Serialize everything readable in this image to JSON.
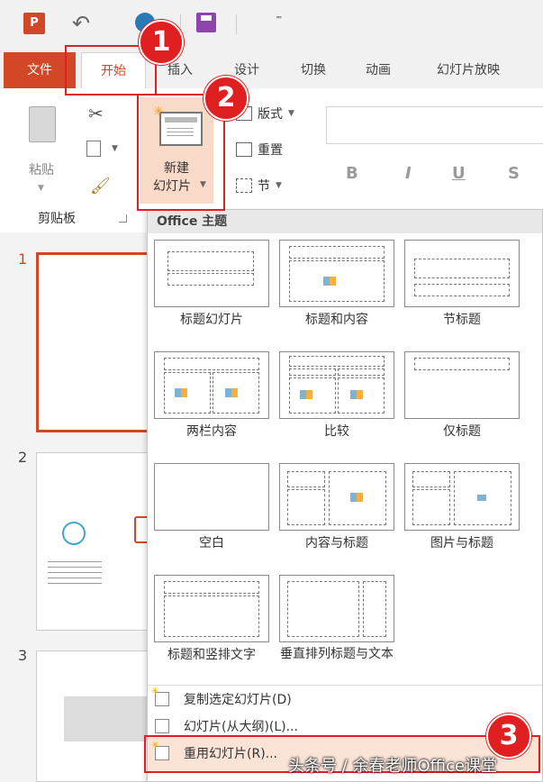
{
  "tabs": {
    "file": "文件",
    "home": "开始",
    "insert": "插入",
    "design": "设计",
    "transitions": "切换",
    "animations": "动画",
    "slideshow": "幻灯片放映"
  },
  "qat": {
    "app_icon_letter": "P",
    "more": "⁼"
  },
  "clipboard": {
    "paste": "粘贴",
    "group_label": "剪贴板"
  },
  "slides_group": {
    "new_slide_line1": "新建",
    "new_slide_line2": "幻灯片",
    "layout": "版式",
    "reset": "重置",
    "section": "节"
  },
  "font_group": {
    "bold": "B",
    "italic": "I",
    "underline": "U",
    "shadow": "S"
  },
  "badges": {
    "one": "1",
    "two": "2",
    "three": "3"
  },
  "slide_panel": {
    "numbers": [
      "1",
      "2",
      "3"
    ]
  },
  "dropdown": {
    "header": "Office 主题",
    "layouts": [
      "标题幻灯片",
      "标题和内容",
      "节标题",
      "两栏内容",
      "比较",
      "仅标题",
      "空白",
      "内容与标题",
      "图片与标题",
      "标题和竖排文字",
      "垂直排列标题与文本"
    ],
    "menu": [
      "复制选定幻灯片(D)",
      "幻灯片(从大纲)(L)...",
      "重用幻灯片(R)..."
    ]
  },
  "watermark": "头条号 / 余春老师Office课堂",
  "colors": {
    "accent": "#d24726",
    "highlight": "#e02020",
    "selection_bg": "#f9d9c8"
  }
}
